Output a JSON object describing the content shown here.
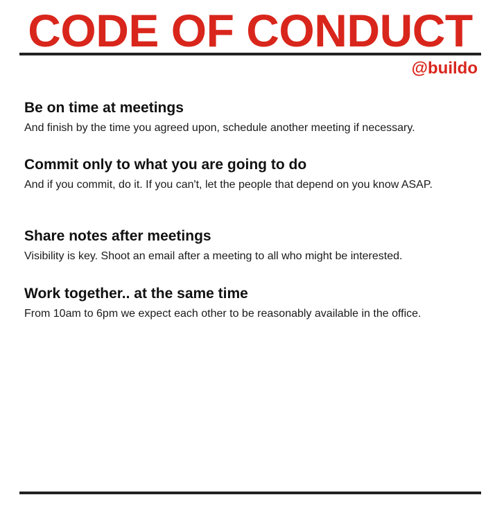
{
  "header": {
    "title": "CODE OF CONDUCT",
    "handle": "@buildo"
  },
  "rules": [
    {
      "heading": "Be on time at meetings",
      "text": "And finish by the time you agreed upon, schedule another meeting if necessary."
    },
    {
      "heading": "Commit only to what you are going to do",
      "text": "And if you commit, do it. If you can't, let the people that depend on you know ASAP."
    },
    {
      "heading": "Share notes after meetings",
      "text": "Visibility is key. Shoot an email after a meeting to all who might be interested."
    },
    {
      "heading": "Work together.. at the same time",
      "text": "From 10am to 6pm we expect each other to be reasonably available in the office."
    }
  ],
  "colors": {
    "accent": "#d9261c",
    "rule": "#222222",
    "text": "#111111"
  }
}
